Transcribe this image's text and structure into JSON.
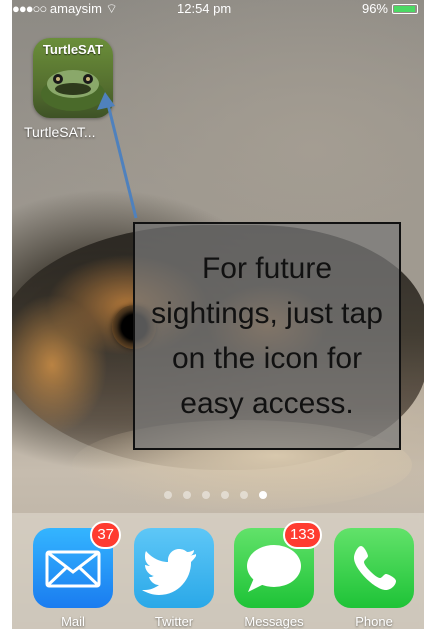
{
  "status_bar": {
    "signal": "●●●○○",
    "carrier": "amaysim",
    "time": "12:54 pm",
    "battery": "96%",
    "battery_level": 0.96
  },
  "home_app": {
    "icon_title": "TurtleSAT",
    "label": "TurtleSAT..."
  },
  "callout": {
    "text": "For future sightings, just tap on the icon for easy access."
  },
  "page_indicator": {
    "count": 6,
    "active_index": 5
  },
  "dock": {
    "apps": [
      {
        "label": "Mail",
        "badge": "37",
        "icon": "mail-envelope-icon"
      },
      {
        "label": "Twitter",
        "badge": "",
        "icon": "twitter-bird-icon"
      },
      {
        "label": "Messages",
        "badge": "133",
        "icon": "speech-bubble-icon"
      },
      {
        "label": "Phone",
        "badge": "",
        "icon": "phone-handset-icon"
      }
    ]
  },
  "colors": {
    "badge": "#ff3b30",
    "arrow": "#4f81bd",
    "callout_bg": "#787878"
  }
}
